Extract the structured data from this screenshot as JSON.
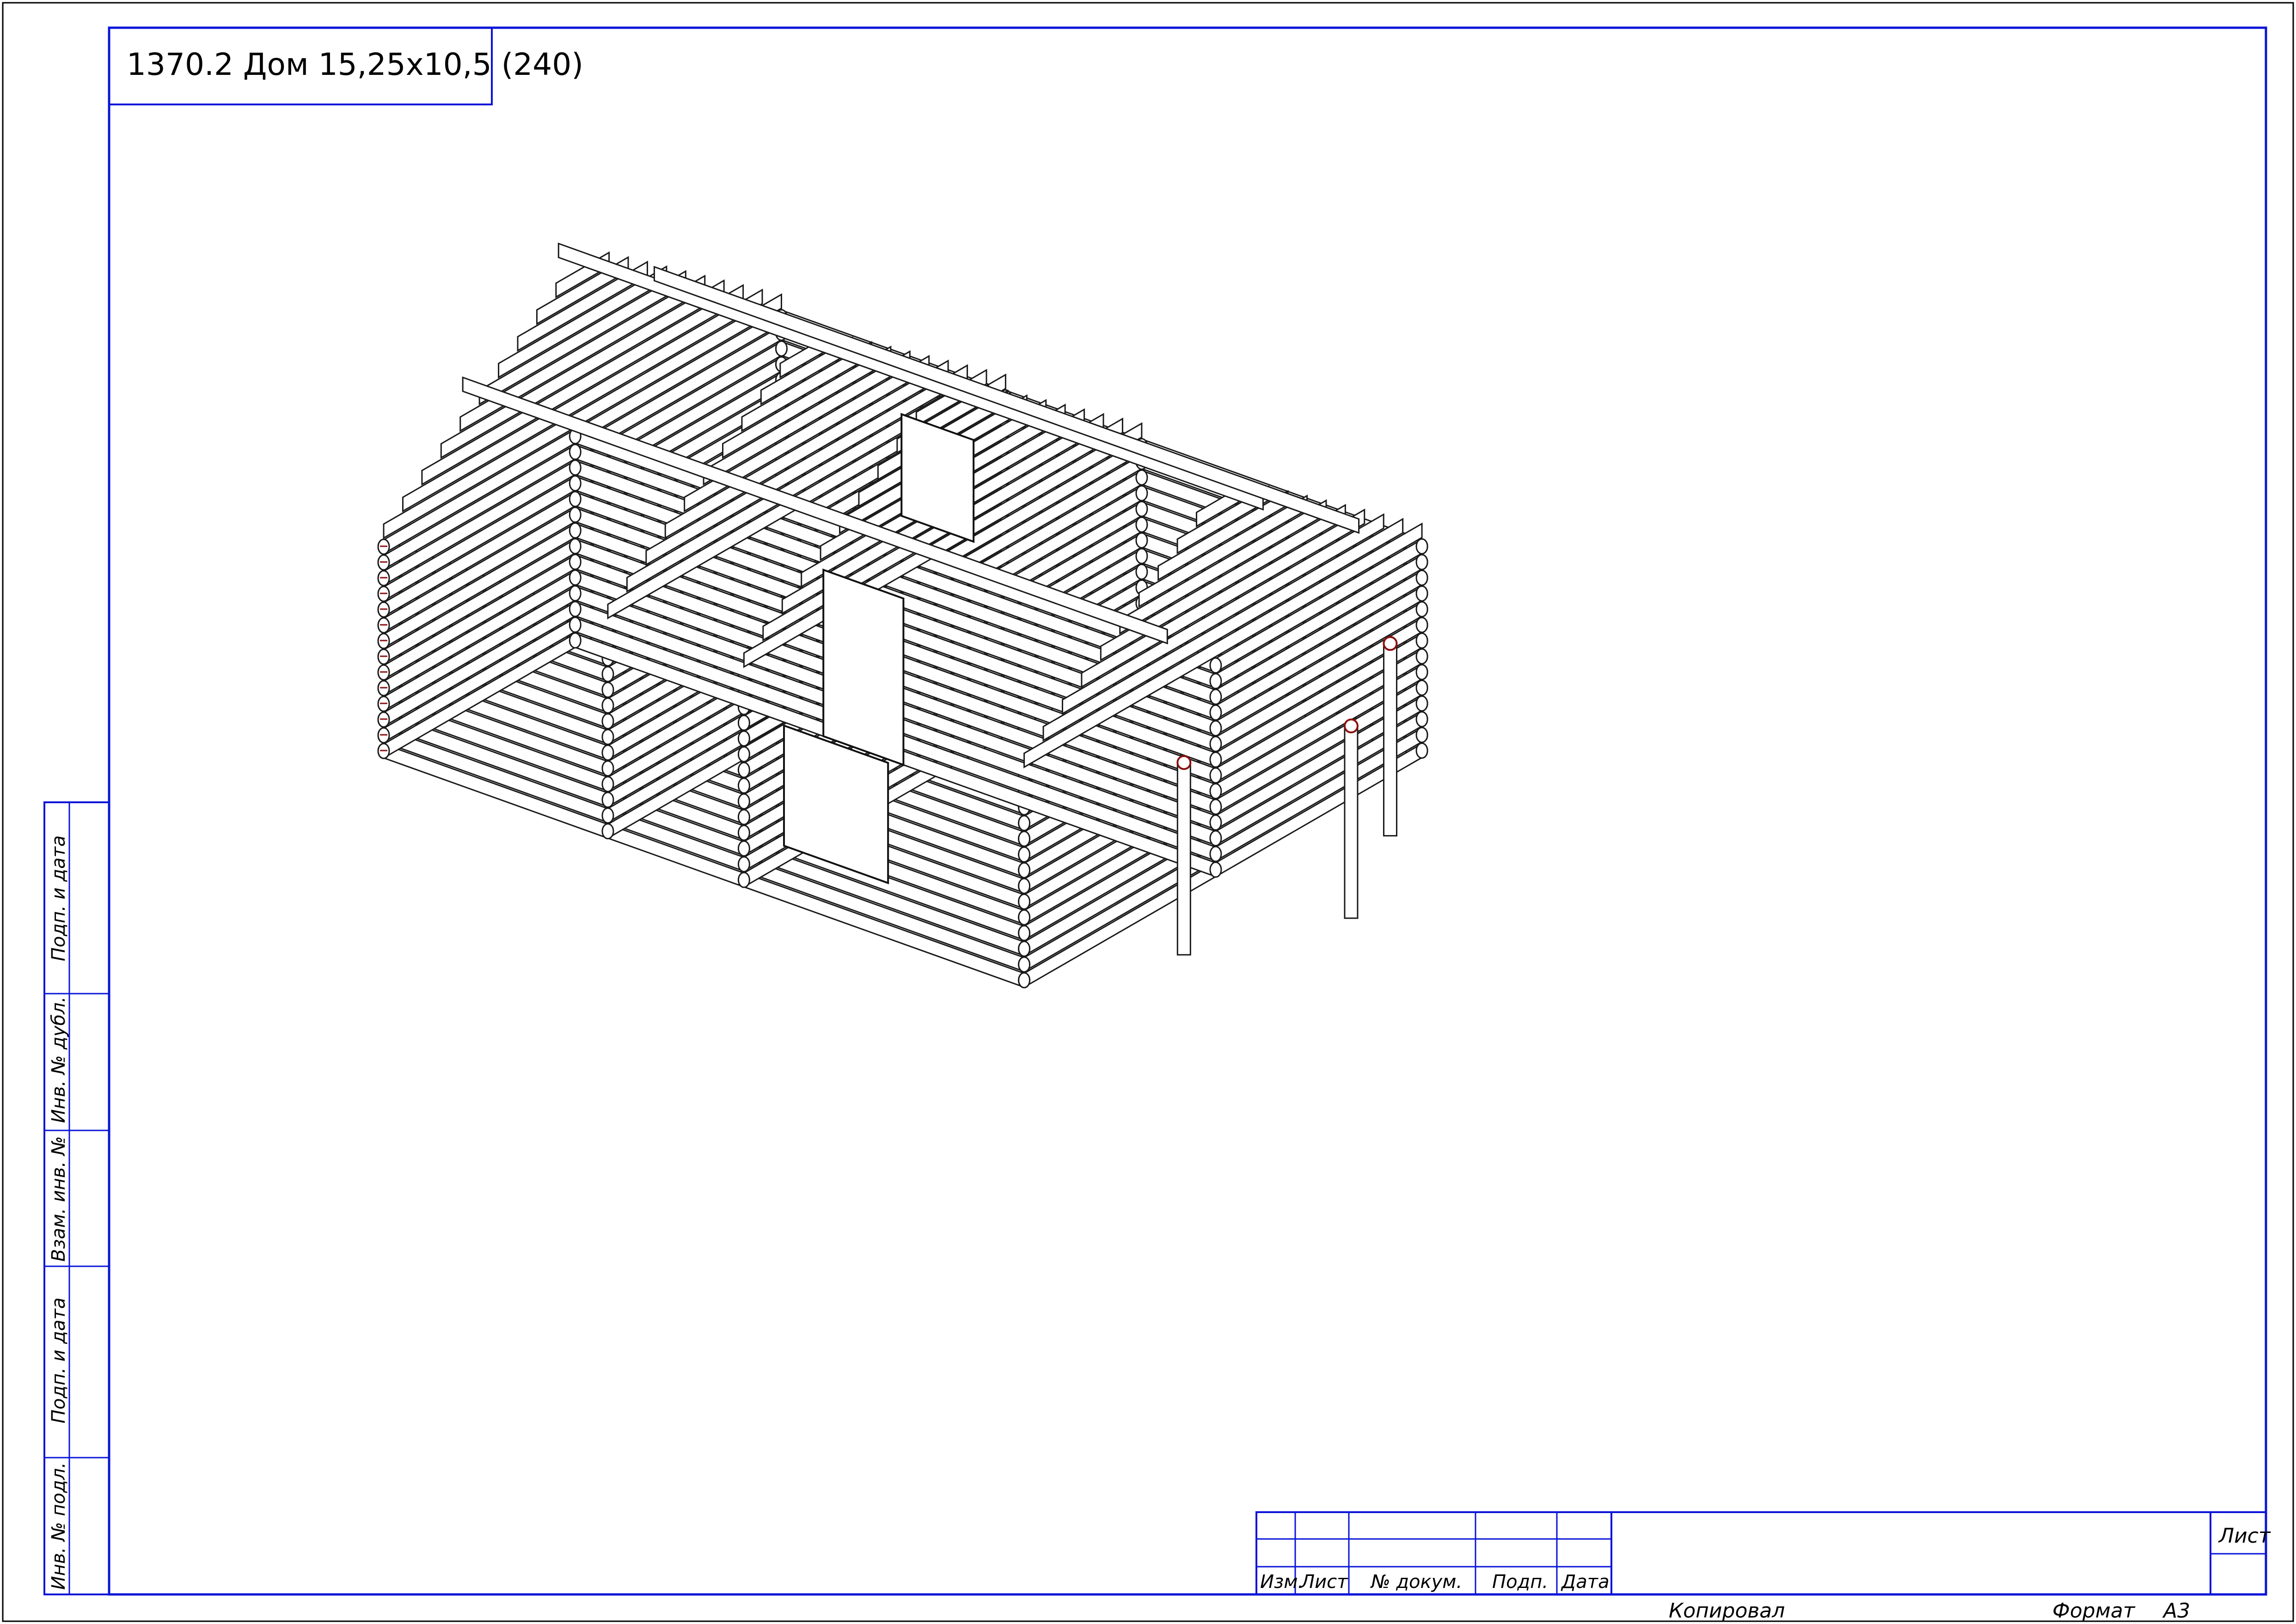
{
  "drawing": {
    "title": "1370.2 Дом 15,25x10,5 (240)"
  },
  "side_stamp": {
    "cells": [
      "Подп. и дата",
      "Инв. № дубл.",
      "Взам. инв. №",
      "Подп. и дата",
      "Инв. № подл."
    ]
  },
  "title_block": {
    "headers": [
      "Изм.",
      "Лист",
      "№ докум.",
      "Подп.",
      "Дата"
    ],
    "sheet_label": "Лист",
    "copied_label": "Копировал",
    "format_label": "Формат",
    "format_value": "А3"
  },
  "colors": {
    "frame": "#0a14d8",
    "line": "#1a1a1a",
    "accent": "#8a1010",
    "background": "#ffffff"
  }
}
